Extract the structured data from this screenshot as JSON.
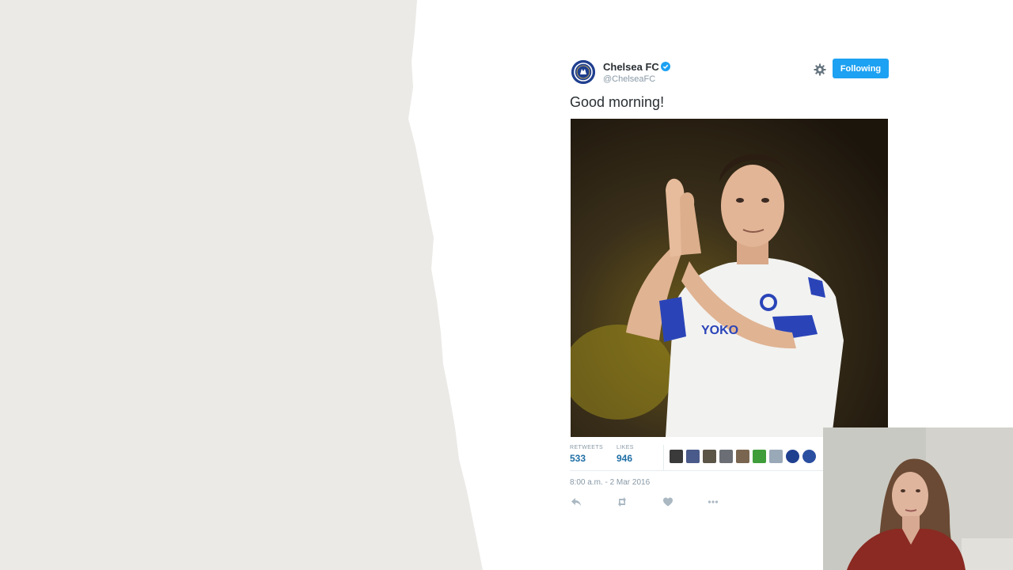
{
  "tweet": {
    "display_name": "Chelsea FC",
    "handle": "@ChelseaFC",
    "follow_label": "Following",
    "text": "Good morning!",
    "stats": {
      "retweets_label": "RETWEETS",
      "retweets": "533",
      "likes_label": "LIKES",
      "likes": "946"
    },
    "timestamp": "8:00 a.m. - 2 Mar 2016"
  },
  "icons": {
    "avatar": "chelsea-crest-icon",
    "verified": "verified-badge-icon",
    "gear": "gear-icon",
    "reply": "reply-icon",
    "retweet": "retweet-icon",
    "like": "heart-icon",
    "more": "more-icon"
  },
  "colors": {
    "follow_button": "#1da1f2",
    "stat_numbers": "#1f6fa6",
    "muted_text": "#8899a6",
    "torn_paper": "#ebeae7",
    "chelsea_blue": "#1f3f8f"
  }
}
